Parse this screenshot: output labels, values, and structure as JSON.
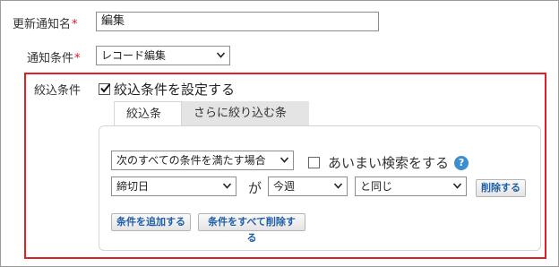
{
  "form": {
    "name_label": "更新通知名",
    "name_required": "*",
    "name_value": "編集",
    "condition_label": "通知条件",
    "condition_required": "*",
    "condition_value": "レコード編集"
  },
  "filter": {
    "label": "絞込条件",
    "checkbox_label": "絞込条件を設定する",
    "checked": true,
    "tabs": [
      {
        "label": "絞込条件",
        "active": true
      },
      {
        "label": "さらに絞り込む条件",
        "active": false
      }
    ],
    "match_select": "次のすべての条件を満たす場合",
    "fuzzy_label": "あいまい検索をする",
    "fuzzy_checked": false,
    "help_icon": "?",
    "row": {
      "field": "締切日",
      "ga": "が",
      "value": "今週",
      "operator": "と同じ",
      "delete_label": "削除する"
    },
    "add_label": "条件を追加する",
    "delete_all_label": "条件をすべて削除する"
  },
  "colors": {
    "highlight_border": "#e01f26",
    "required": "#e0141e",
    "button_text": "#1f5fa8",
    "help_icon_bg": "#3b8fd0"
  }
}
